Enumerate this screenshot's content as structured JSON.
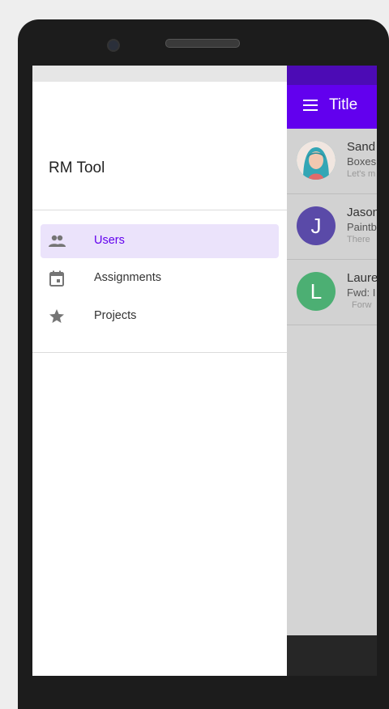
{
  "app": {
    "title": "Title",
    "list": [
      {
        "name": "Sand",
        "subject": "Boxes",
        "preview": "Let's m",
        "avatar_letter": "",
        "avatar_color": "#3a9aa5",
        "avatar_type": "photo"
      },
      {
        "name": "Jason",
        "subject": "Paintb",
        "preview": "There",
        "avatar_letter": "J",
        "avatar_color": "#5a4aa8",
        "avatar_type": "letter"
      },
      {
        "name": "Laure",
        "subject": "Fwd: I",
        "preview": "Forw",
        "avatar_letter": "L",
        "avatar_color": "#4caf73",
        "avatar_type": "letter"
      }
    ]
  },
  "drawer": {
    "title": "RM Tool",
    "items": [
      {
        "label": "Users",
        "icon": "people-icon",
        "active": true
      },
      {
        "label": "Assignments",
        "icon": "calendar-icon",
        "active": false
      },
      {
        "label": "Projects",
        "icon": "star-icon",
        "active": false
      }
    ]
  },
  "colors": {
    "primary": "#6200ee",
    "status_bar": "#4c0bb5",
    "active_bg": "#ebe3fb"
  }
}
